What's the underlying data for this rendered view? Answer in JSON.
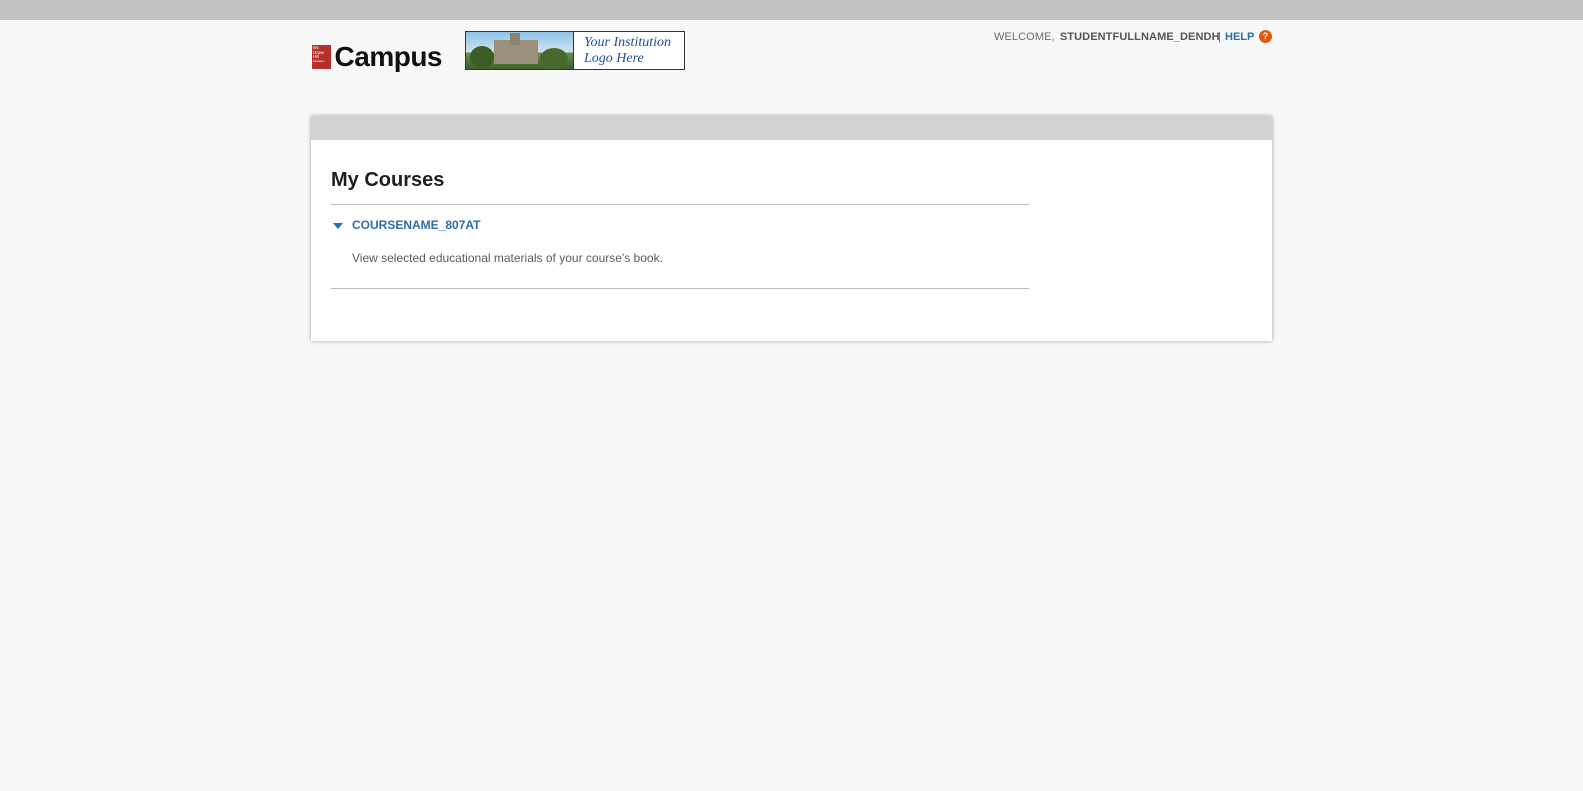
{
  "header": {
    "brand_box": [
      "Mc",
      "Graw",
      "Hill",
      "Education"
    ],
    "brand_name": "Campus",
    "institution_logo": {
      "line1": "Your Institution",
      "line2": "Logo Here"
    },
    "welcome_label": "WELCOME,",
    "username": "STUDENTFULLNAME_DENDH",
    "separator": "|",
    "help_label": "HELP",
    "help_icon_glyph": "?"
  },
  "main": {
    "title": "My Courses",
    "courses": [
      {
        "name": "COURSENAME_807AT",
        "description": "View selected educational materials of your course's book."
      }
    ]
  },
  "colors": {
    "accent": "#2d6ea8",
    "help_icon": "#e2570b",
    "brand_red": "#b5302a"
  }
}
